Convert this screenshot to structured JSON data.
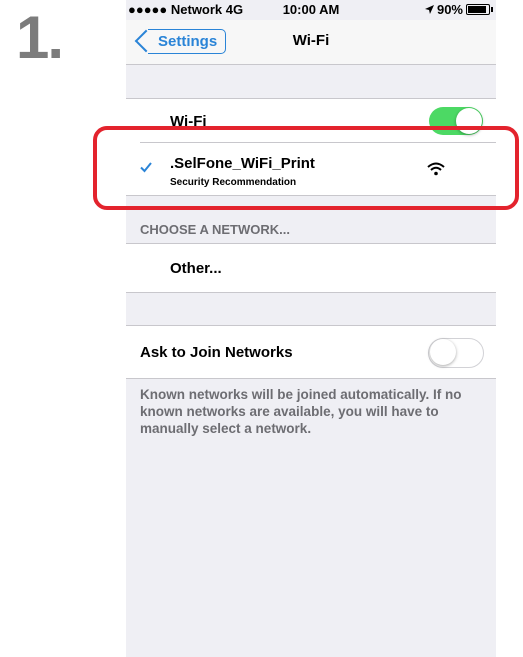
{
  "step": {
    "number": "1."
  },
  "status_bar": {
    "carrier": "●●●●● Network 4G",
    "time": "10:00 AM",
    "battery": "90%",
    "location_icon": "location-arrow-icon",
    "battery_icon": "battery-icon"
  },
  "navbar": {
    "back_label": "Settings",
    "title": "Wi-Fi"
  },
  "wifi_row": {
    "label": "Wi-Fi",
    "toggle_on": true
  },
  "connected_network": {
    "name": ".SelFone_WiFi_Print",
    "subtitle": "Security Recommendation",
    "check_icon": "checkmark-icon",
    "signal_icon": "wifi-signal-icon"
  },
  "choose_section": {
    "header": "CHOOSE A NETWORK..."
  },
  "other_row": {
    "label": "Other..."
  },
  "ask_row": {
    "label": "Ask to Join Networks",
    "toggle_on": false
  },
  "footer": {
    "text": "Known networks will be joined automatically. If no known networks are available, you will have to manually select a network."
  },
  "colors": {
    "accent": "#2a84d7",
    "toggle_on": "#4cd964",
    "highlight": "#e3232d"
  }
}
